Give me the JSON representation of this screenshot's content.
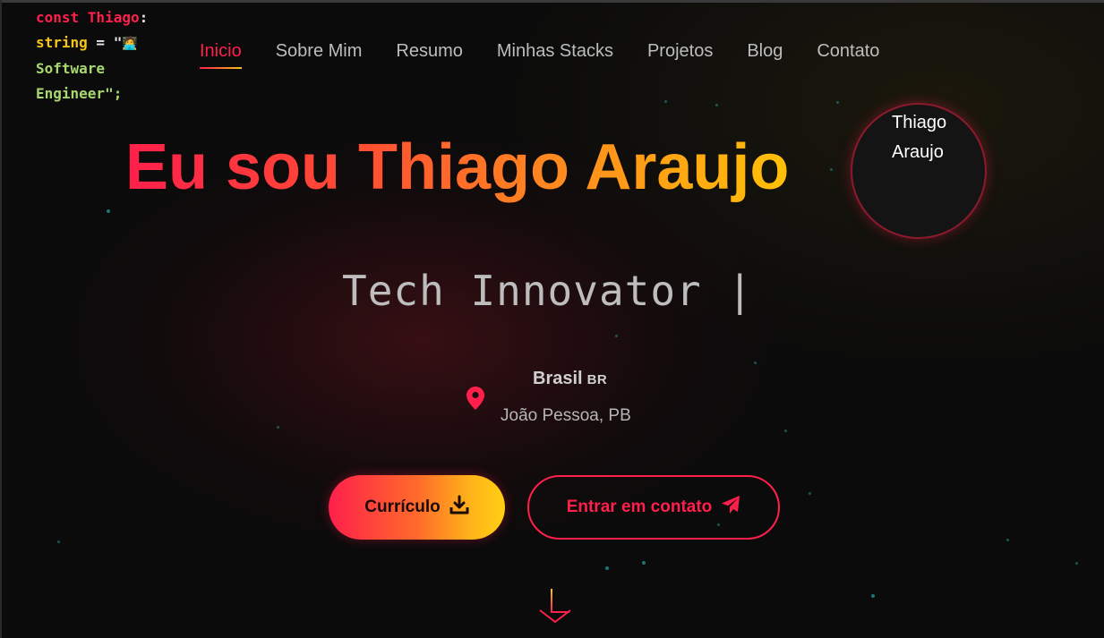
{
  "logo": {
    "line1_keyword": "const Thiago",
    "line1_colon": ":",
    "line2_type": "string",
    "line2_eq": " = \"",
    "line2_emoji": "🧑‍💻",
    "line3_text": "Software",
    "line4_text": "Engineer\";"
  },
  "nav": {
    "items": [
      {
        "label": "Inicio",
        "active": true
      },
      {
        "label": "Sobre Mim",
        "active": false
      },
      {
        "label": "Resumo",
        "active": false
      },
      {
        "label": "Minhas Stacks",
        "active": false
      },
      {
        "label": "Projetos",
        "active": false
      },
      {
        "label": "Blog",
        "active": false
      },
      {
        "label": "Contato",
        "active": false
      }
    ]
  },
  "hero": {
    "title": "Eu sou Thiago Araujo",
    "typed_text": "Tech Innovator |",
    "avatar_alt": "Thiago Araujo"
  },
  "location": {
    "country": "Brasil",
    "flag": "BR",
    "city": "João Pessoa, PB",
    "icon": "location-pin-icon"
  },
  "buttons": {
    "cv_label": "Currículo",
    "cv_icon": "download-icon",
    "contact_label": "Entrar em contato",
    "contact_icon": "paper-plane-icon"
  },
  "scroll": {
    "icon": "scroll-down-arrow-icon"
  },
  "colors": {
    "accent": "#ff1f4b",
    "accent_secondary": "#f5c518",
    "background": "#0b0b0b",
    "nav_text": "#bdbdbd"
  }
}
